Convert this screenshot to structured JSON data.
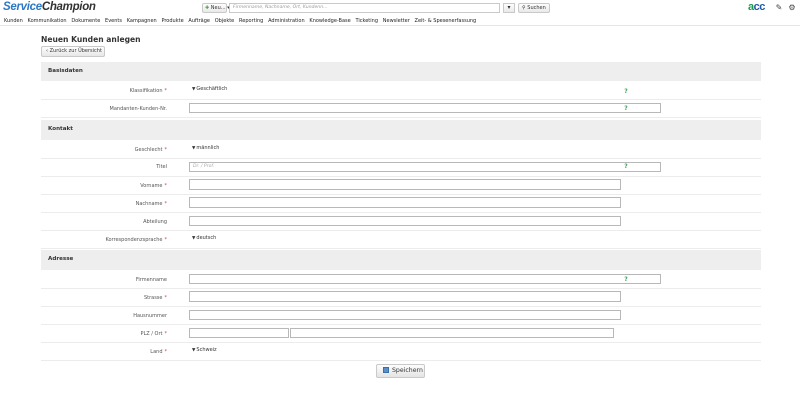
{
  "header": {
    "logo_part1": "Service",
    "logo_part2": "Champion",
    "new_button_label": "Neu...",
    "search_placeholder": "Firmenname, Nachname, Ort, Kundenn...",
    "search_button_label": "Suchen",
    "brand_part1": "a",
    "brand_part2": "cc",
    "icons": [
      "edit-icon",
      "gear-icon"
    ]
  },
  "nav": {
    "items": [
      "Kunden",
      "Kommunikation",
      "Dokumente",
      "Events",
      "Kampagnen",
      "Produkte",
      "Aufträge",
      "Objekte",
      "Reporting",
      "Administration",
      "Knowledge-Base",
      "Ticketing",
      "Newsletter",
      "Zeit- & Spesenerfassung"
    ]
  },
  "page": {
    "title": "Neuen Kunden anlegen",
    "back_button_label": "Zurück zur Übersicht",
    "save_button_label": "Speichern"
  },
  "sections": {
    "basisdaten": {
      "title": "Basisdaten",
      "klassifikation": {
        "label": "Klassifikation",
        "value": "Geschäftlich"
      },
      "mandanten": {
        "label": "Mandanten-Kunden-Nr.",
        "value": ""
      }
    },
    "kontakt": {
      "title": "Kontakt",
      "geschlecht": {
        "label": "Geschlecht",
        "value": "männlich"
      },
      "titel": {
        "label": "Titel",
        "placeholder": "Dr. / Prof."
      },
      "vorname": {
        "label": "Vorname",
        "value": ""
      },
      "nachname": {
        "label": "Nachname",
        "value": ""
      },
      "abteilung": {
        "label": "Abteilung",
        "value": ""
      },
      "korrespondenzsprache": {
        "label": "Korrespondenzsprache",
        "value": "deutsch"
      }
    },
    "adresse": {
      "title": "Adresse",
      "firmenname": {
        "label": "Firmenname",
        "value": ""
      },
      "strasse": {
        "label": "Strasse",
        "value": ""
      },
      "hausnummer": {
        "label": "Hausnummer",
        "value": ""
      },
      "plz_ort": {
        "label": "PLZ / Ort",
        "plz": "",
        "ort": ""
      },
      "land": {
        "label": "Land",
        "value": "Schweiz"
      }
    }
  },
  "common": {
    "required_marker": "*",
    "help_marker": "?",
    "chevron": "⌄"
  },
  "colors": {
    "logo_blue": "#2f78c4",
    "section_bg": "#eeeeee",
    "help_green": "#3aa55a",
    "brand_green": "#1a9a4a",
    "brand_blue": "#1e5aa8"
  }
}
